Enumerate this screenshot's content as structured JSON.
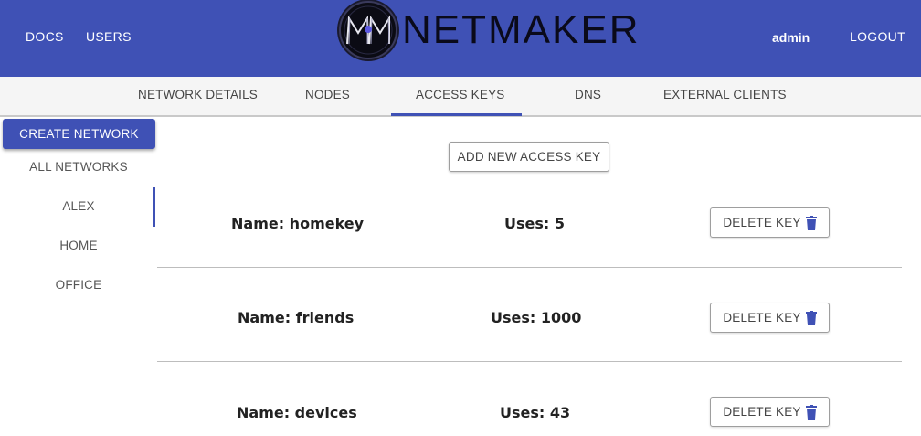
{
  "header": {
    "docs": "DOCS",
    "users": "USERS",
    "logo_text": "NETMAKER",
    "username": "admin",
    "logout": "LOGOUT",
    "brand_color": "#3f51b5"
  },
  "tabs": [
    {
      "label": "NETWORK DETAILS"
    },
    {
      "label": "NODES"
    },
    {
      "label": "ACCESS KEYS",
      "active": true
    },
    {
      "label": "DNS"
    },
    {
      "label": "EXTERNAL CLIENTS"
    }
  ],
  "sidebar": {
    "create_label": "CREATE NETWORK",
    "items": [
      {
        "label": "ALL NETWORKS"
      },
      {
        "label": "ALEX",
        "active": true
      },
      {
        "label": "HOME"
      },
      {
        "label": "OFFICE"
      }
    ]
  },
  "main": {
    "add_label": "ADD NEW ACCESS KEY",
    "keys": [
      {
        "name": "Name: homekey",
        "uses": "Uses: 5",
        "delete_label": "DELETE KEY"
      },
      {
        "name": "Name: friends",
        "uses": "Uses: 1000",
        "delete_label": "DELETE KEY"
      },
      {
        "name": "Name: devices",
        "uses": "Uses: 43",
        "delete_label": "DELETE KEY"
      }
    ],
    "icons": {
      "delete": "trash-icon"
    }
  }
}
